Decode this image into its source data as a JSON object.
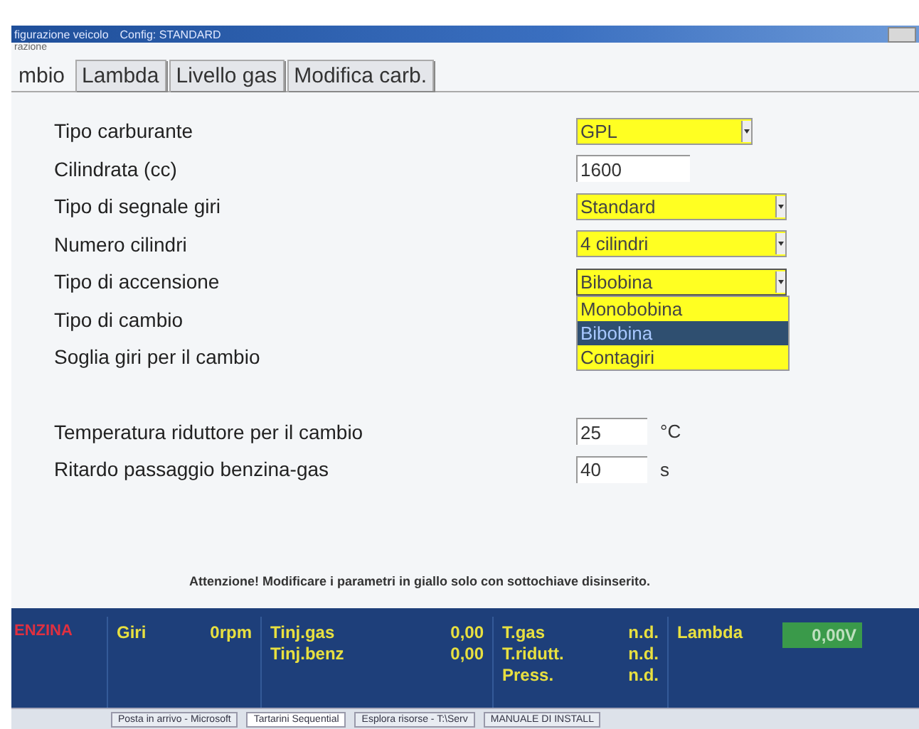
{
  "window": {
    "title": "figurazione veicolo",
    "config": "Config: STANDARD",
    "menu": "razione"
  },
  "tabs": [
    {
      "label": "mbio",
      "selected": true
    },
    {
      "label": "Lambda",
      "selected": false
    },
    {
      "label": "Livello gas",
      "selected": false
    },
    {
      "label": "Modifica carb.",
      "selected": false
    }
  ],
  "fields": [
    {
      "label": "Tipo carburante",
      "kind": "dropdown",
      "value": "GPL",
      "open": false
    },
    {
      "label": "Cilindrata (cc)",
      "kind": "input",
      "value": "1600"
    },
    {
      "label": "Tipo di segnale giri",
      "kind": "dropdown",
      "value": "Standard",
      "open": false
    },
    {
      "label": "Numero cilindri",
      "kind": "dropdown",
      "value": "4 cilindri",
      "open": false
    },
    {
      "label": "Tipo di accensione",
      "kind": "dropdown",
      "value": "Bibobina",
      "open": true,
      "options": [
        {
          "label": "Monobobina",
          "selected": false
        },
        {
          "label": "Bibobina",
          "selected": true
        },
        {
          "label": "Contagiri",
          "selected": false
        }
      ]
    },
    {
      "label": "Tipo di cambio",
      "kind": "covered"
    },
    {
      "label": "Soglia giri per il cambio",
      "kind": "covered"
    }
  ],
  "extra_fields": [
    {
      "label": "Temperatura riduttore per il cambio",
      "value": "25",
      "unit": "°C"
    },
    {
      "label": "Ritardo passaggio benzina-gas",
      "value": "40",
      "unit": "s"
    }
  ],
  "notice": "Attenzione! Modificare i parametri in giallo solo con sottochiave disinserito.",
  "status_bar": {
    "mode": "ENZINA",
    "rpm_label": "Giri",
    "rpm_value": "0rpm",
    "injection": [
      {
        "label": "Tinj.gas",
        "value": "0,00"
      },
      {
        "label": "Tinj.benz",
        "value": "0,00"
      }
    ],
    "sensors": [
      {
        "label": "T.gas",
        "value": "n.d."
      },
      {
        "label": "T.ridutt.",
        "value": "n.d."
      },
      {
        "label": "Press.",
        "value": "n.d."
      }
    ],
    "lambda_label": "Lambda",
    "lambda_value": "0,00V"
  },
  "taskbar": [
    {
      "label": "Posta in arrivo - Microsoft",
      "selected": false
    },
    {
      "label": "Tartarini Sequential",
      "selected": true
    },
    {
      "label": "Esplora risorse - T:\\Serv",
      "selected": false
    },
    {
      "label": "MANUALE DI INSTALL",
      "selected": false
    }
  ]
}
